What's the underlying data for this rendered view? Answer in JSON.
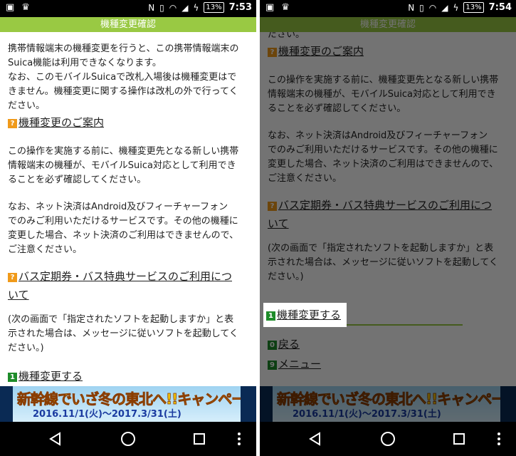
{
  "left": {
    "status": {
      "time": "7:53",
      "battery": "13%"
    },
    "title": "機種変更確認",
    "intro_lines": [
      "携帯情報端末の機種変更を行うと、この携帯情報端末の",
      "Suica機能は利用できなくなります。",
      "なお、このモバイルSuicaで改札入場後は機種変更はで",
      "きません。機種変更に関する操作は改札の外で行ってく",
      "ださい。"
    ],
    "heading1": "機種変更のご案内",
    "para1_lines": [
      "この操作を実施する前に、機種変更先となる新しい携帯",
      "情報端末の機種が、モバイルSuica対応として利用でき",
      "ることを必ず確認してください。"
    ],
    "para2_lines": [
      "なお、ネット決済はAndroid及びフィーチャーフォン",
      "でのみご利用いただけるサービスです。その他の機種に",
      "変更した場合、ネット決済のご利用はできませんので、",
      "ご注意ください。"
    ],
    "heading2_line1": "バス定期券・バス特典サービスのご利用につ",
    "heading2_line2": "いて",
    "para3_lines": [
      "(次の画面で「指定されたソフトを起動しますか」と表",
      "示された場合は、メッセージに従いソフトを起動してく",
      "ださい。)"
    ],
    "action_num": "1",
    "action_label": "機種変更する"
  },
  "right": {
    "status": {
      "time": "7:54",
      "battery": "13%"
    },
    "title": "機種変更確認",
    "top_fragment": "ださい。",
    "heading1": "機種変更のご案内",
    "para1_lines": [
      "この操作を実施する前に、機種変更先となる新しい携帯",
      "情報端末の機種が、モバイルSuica対応として利用でき",
      "ることを必ず確認してください。"
    ],
    "para2_lines": [
      "なお、ネット決済はAndroid及びフィーチャーフォン",
      "でのみご利用いただけるサービスです。その他の機種に",
      "変更した場合、ネット決済のご利用はできませんので、",
      "ご注意ください。"
    ],
    "heading2_line1": "バス定期券・バス特典サービスのご利用につ",
    "heading2_line2": "いて",
    "para3_lines": [
      "(次の画面で「指定されたソフトを起動しますか」と表",
      "示された場合は、メッセージに従いソフトを起動してく",
      "ださい。)"
    ],
    "action_num": "1",
    "action_label": "機種変更する",
    "back_num": "0",
    "back_label": "戻る",
    "menu_num": "9",
    "menu_label": "メニュー"
  },
  "banner": {
    "text": "新幹線でいざ冬の東北へ!!キャンペーン",
    "date": "2016.11/1(火)〜2017.3/31(土)"
  },
  "icons": {
    "question": "?",
    "back": "back-triangle-icon",
    "home": "home-circle-icon",
    "recents": "recents-square-icon",
    "menu": "overflow-dots-icon"
  },
  "colors": {
    "title_bar": "#99c943",
    "question_icon": "#f09a1a",
    "number_icon": "#1e8c2a"
  }
}
